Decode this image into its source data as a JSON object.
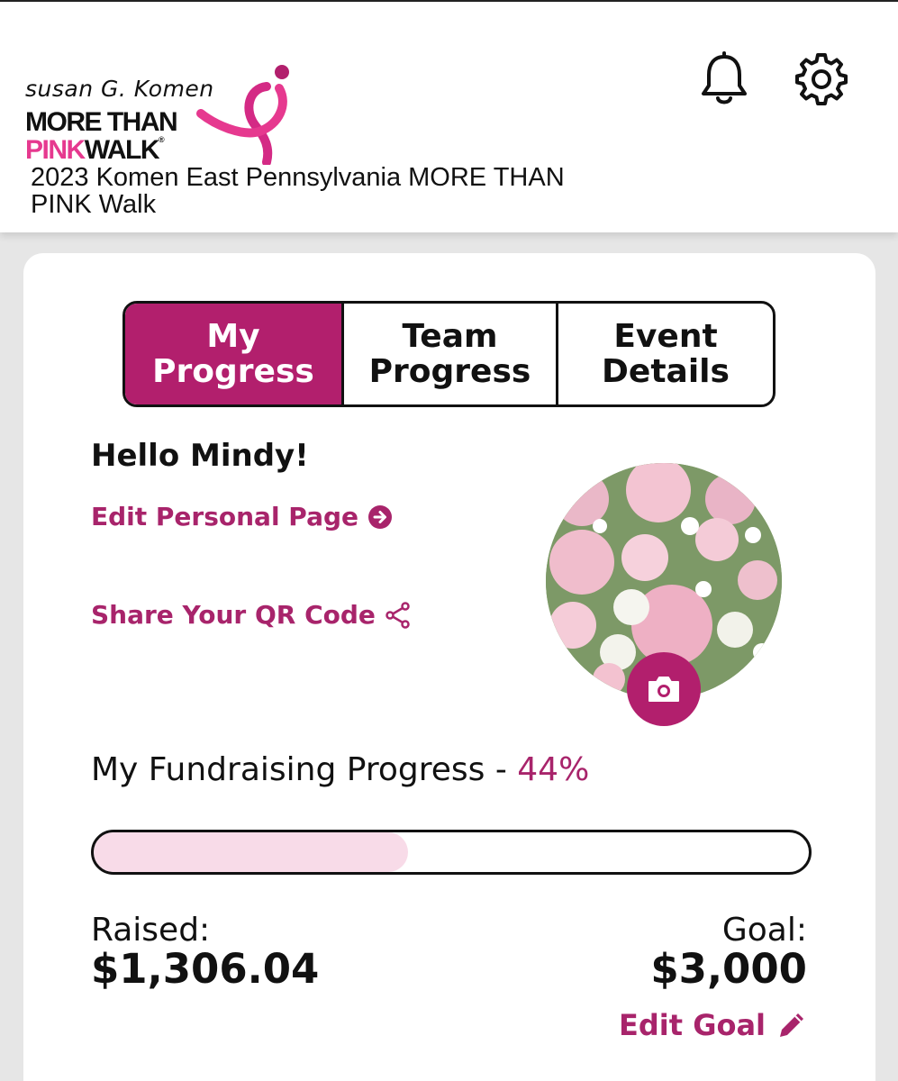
{
  "header": {
    "logo": {
      "org": "susan G. Komen",
      "line1": "MORE THAN",
      "line2_pink": "PINK",
      "line2_dark": "WALK",
      "registered": "®"
    },
    "event_title": "2023 Komen East Pennsylvania MORE THAN PINK Walk",
    "icons": [
      "bell-icon",
      "gear-icon"
    ]
  },
  "tabs": [
    {
      "label": "My Progress",
      "active": true
    },
    {
      "label": "Team Progress",
      "active": false
    },
    {
      "label": "Event Details",
      "active": false
    }
  ],
  "greeting": "Hello Mindy!",
  "links": {
    "edit_personal_page": "Edit Personal Page",
    "share_qr": "Share Your QR Code",
    "edit_goal": "Edit Goal"
  },
  "fundraising": {
    "label": "My Fundraising Progress - ",
    "percent_text": "44%",
    "progress_fraction": 0.44,
    "raised_label": "Raised:",
    "raised_value": "$1,306.04",
    "goal_label": "Goal:",
    "goal_value": "$3,000"
  },
  "colors": {
    "brand_magenta": "#b21f6d",
    "link_magenta": "#a8246b",
    "logo_pink": "#e6398f",
    "progress_fill": "#f8dbe8"
  }
}
